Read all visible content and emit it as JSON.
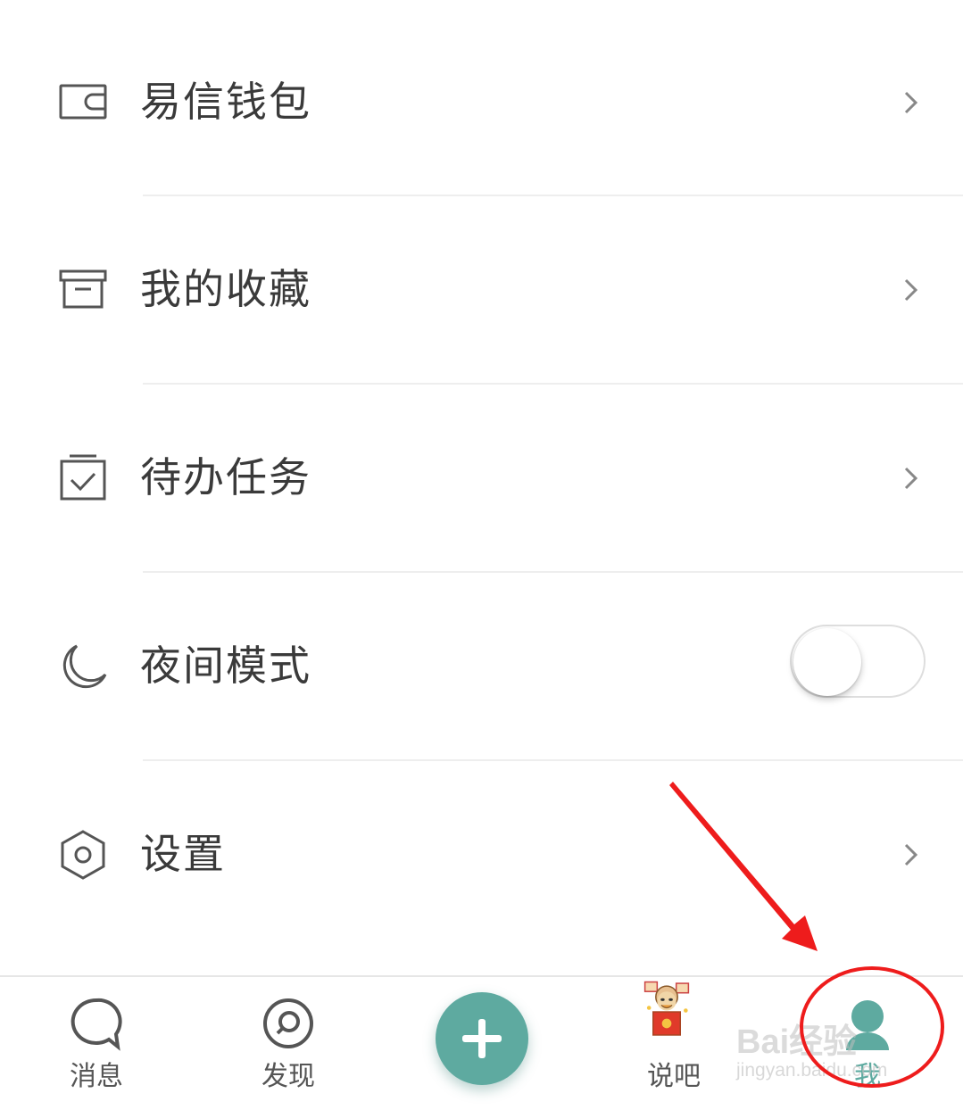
{
  "menu": {
    "items": [
      {
        "label": "易信钱包",
        "icon": "wallet-icon",
        "trailing": "chevron"
      },
      {
        "label": "我的收藏",
        "icon": "archive-box-icon",
        "trailing": "chevron"
      },
      {
        "label": "待办任务",
        "icon": "calendar-check-icon",
        "trailing": "chevron"
      },
      {
        "label": "夜间模式",
        "icon": "moon-icon",
        "trailing": "toggle",
        "toggle_on": false
      },
      {
        "label": "设置",
        "icon": "hexagon-gear-icon",
        "trailing": "chevron"
      }
    ]
  },
  "tabbar": {
    "tabs": [
      {
        "label": "消息",
        "icon": "chat-bubble-icon",
        "active": false
      },
      {
        "label": "发现",
        "icon": "discover-icon",
        "active": false
      },
      {
        "label": "",
        "icon": "plus-icon",
        "active": false
      },
      {
        "label": "说吧",
        "icon": "mascot-icon",
        "active": false
      },
      {
        "label": "我",
        "icon": "person-icon",
        "active": true
      }
    ]
  },
  "watermark": {
    "brand": "Bai经验",
    "url": "jingyan.baidu.com"
  },
  "colors": {
    "accent": "#5eaaa0",
    "text": "#3a3a3a",
    "annotation": "#ee1c1c"
  }
}
